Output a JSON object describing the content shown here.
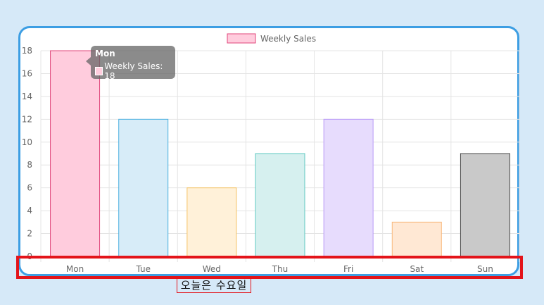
{
  "chart_data": {
    "type": "bar",
    "categories": [
      "Mon",
      "Tue",
      "Wed",
      "Thu",
      "Fri",
      "Sat",
      "Sun"
    ],
    "series": [
      {
        "name": "Weekly Sales",
        "values": [
          18,
          12,
          6,
          9,
          12,
          3,
          9
        ]
      }
    ],
    "ylim": [
      0,
      18
    ],
    "yticks": [
      0,
      2,
      4,
      6,
      8,
      10,
      12,
      14,
      16,
      18
    ],
    "grid": true,
    "legend_position": "top",
    "bar_fill_colors": [
      "#ffccdd",
      "#d7ecf8",
      "#fff1d9",
      "#d6f0ef",
      "#e7dcfd",
      "#ffe8d4",
      "#c9c9c9"
    ],
    "bar_border_colors": [
      "#e0457a",
      "#4ab0e0",
      "#f5c262",
      "#5ec8c1",
      "#b99af7",
      "#f8b77a",
      "#4a4a4a"
    ]
  },
  "tooltip": {
    "title": "Mon",
    "label": "Weekly Sales: 18"
  },
  "caption": "오늘은 수요일",
  "colors": {
    "background": "#d6e9f8",
    "card_border": "#3d9ee3",
    "highlight": "#e3141a"
  }
}
